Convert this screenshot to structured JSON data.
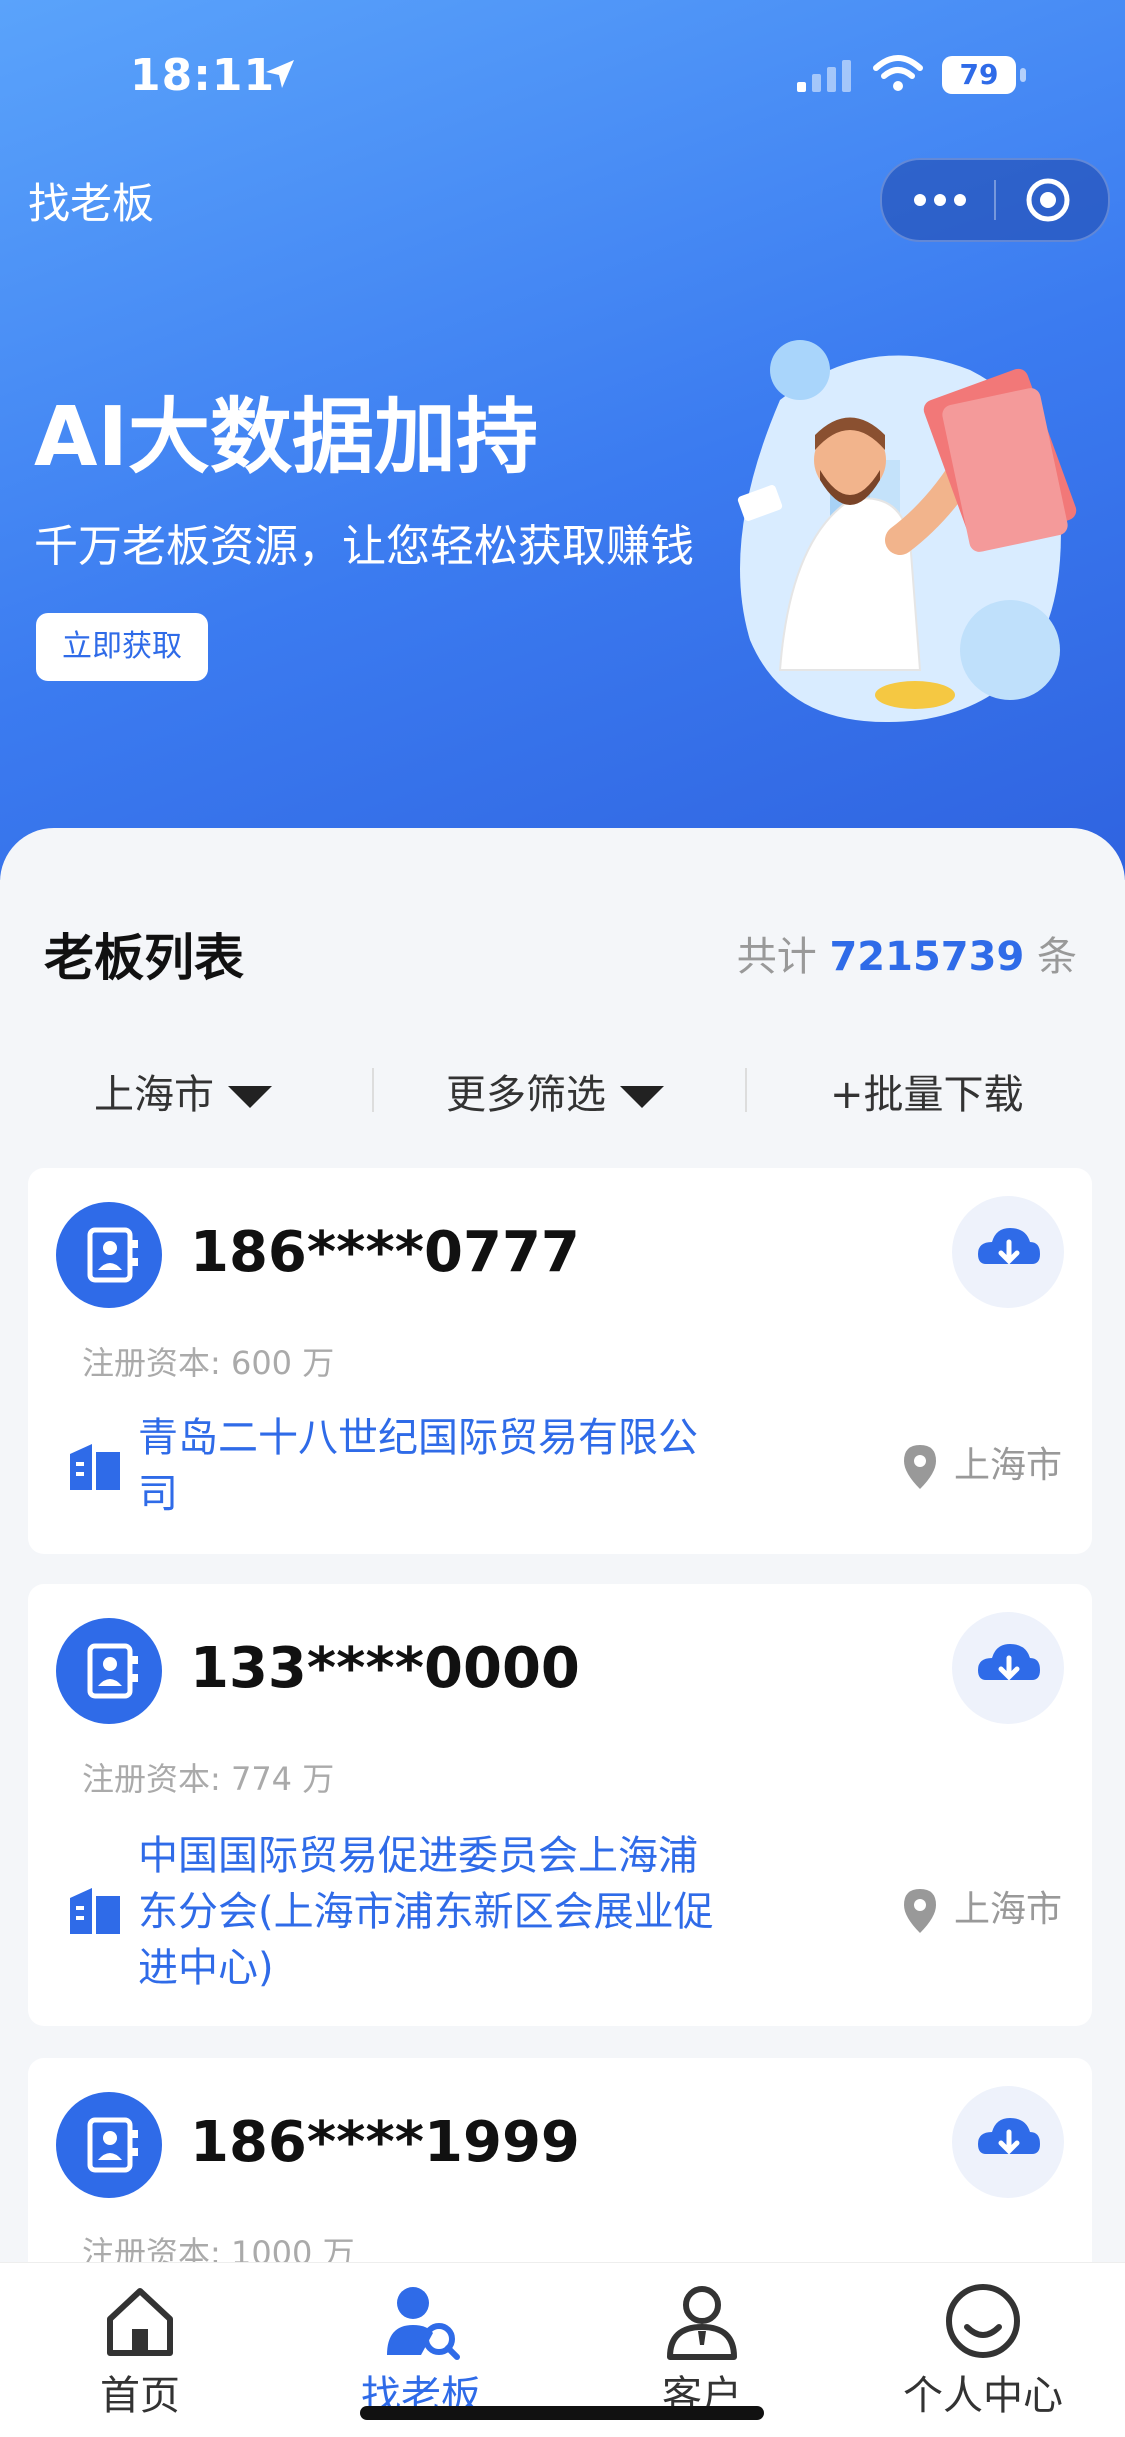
{
  "status_bar": {
    "time": "18:11",
    "battery": "79"
  },
  "nav": {
    "title": "找老板"
  },
  "banner": {
    "title": "AI大数据加持",
    "subtitle": "千万老板资源，让您轻松获取赚钱",
    "button": "立即获取"
  },
  "list": {
    "title": "老板列表",
    "count_prefix": "共计",
    "count": "7215739",
    "count_suffix": "条"
  },
  "filters": {
    "city": "上海市",
    "more": "更多筛选",
    "batch": "+批量下载"
  },
  "cards": [
    {
      "phone": "186****0777",
      "capital": "注册资本: 600 万",
      "company": "青岛二十八世纪国际贸易有限公司",
      "company_lines": [
        "青岛二十八世纪国际贸易有限公",
        "司"
      ],
      "location": "上海市"
    },
    {
      "phone": "133****0000",
      "capital": "注册资本: 774 万",
      "company": "中国国际贸易促进委员会上海浦东分会(上海市浦东新区会展业促进中心)",
      "company_lines": [
        "中国国际贸易促进委员会上海浦",
        "东分会(上海市浦东新区会展业促",
        "进中心)"
      ],
      "location": "上海市"
    },
    {
      "phone": "186****1999",
      "capital": "注册资本: 1000 万"
    }
  ],
  "tabbar": {
    "items": [
      {
        "label": "首页"
      },
      {
        "label": "找老板"
      },
      {
        "label": "客户"
      },
      {
        "label": "个人中心"
      }
    ],
    "active_index": 1
  },
  "colors": {
    "primary": "#2f6be8",
    "gradient_top": "#5aa3fb",
    "gradient_bottom": "#2f63e0"
  }
}
